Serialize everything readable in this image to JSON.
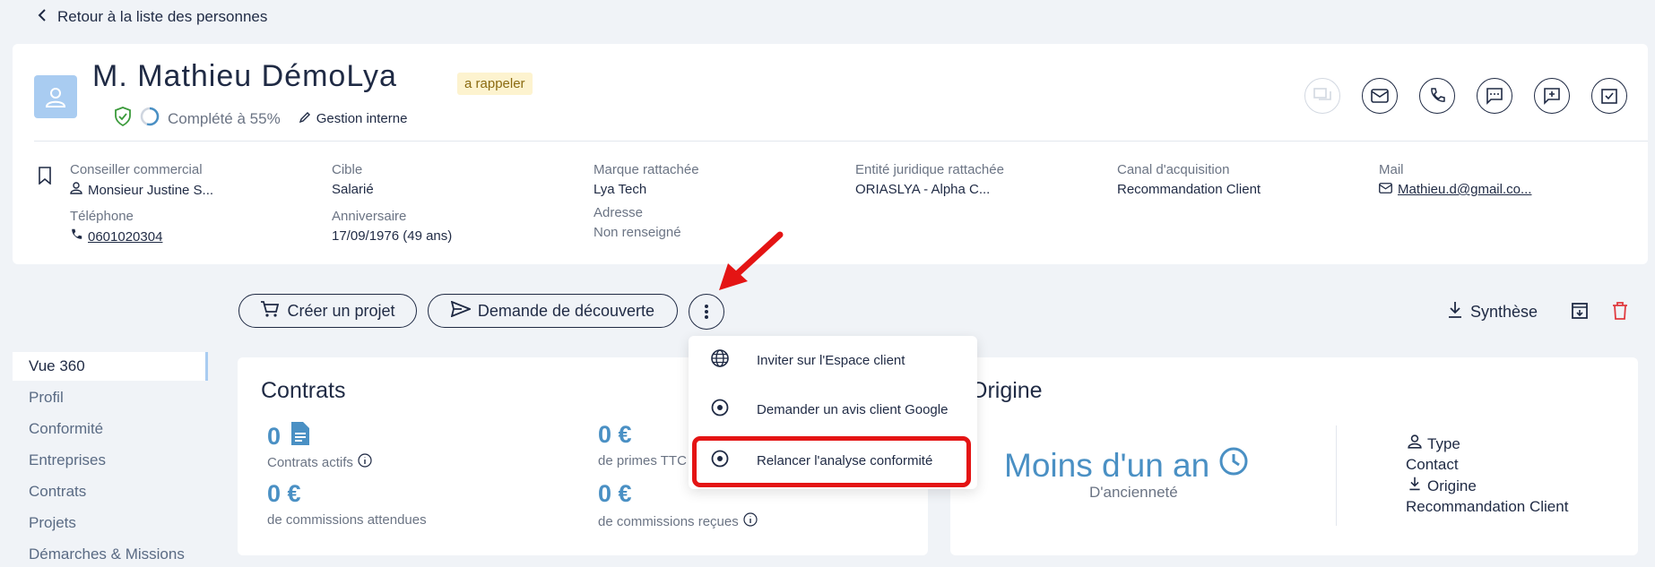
{
  "back_link": "Retour à la liste des personnes",
  "person": {
    "name": "M. Mathieu DémoLya",
    "badge": "a rappeler",
    "completion": "Complété à 55%",
    "completion_fraction": 0.55,
    "internal": "Gestion interne"
  },
  "fields": {
    "conseiller_label": "Conseiller commercial",
    "conseiller_value": "Monsieur Justine S...",
    "telephone_label": "Téléphone",
    "telephone_value": "0601020304",
    "cible_label": "Cible",
    "cible_value": "Salarié",
    "anniversaire_label": "Anniversaire",
    "anniversaire_value": "17/09/1976 (49 ans)",
    "marque_label": "Marque rattachée",
    "marque_value": "Lya Tech",
    "adresse_label": "Adresse",
    "adresse_value": "Non renseigné",
    "entite_label": "Entité juridique rattachée",
    "entite_value": "ORIASLYA - Alpha C...",
    "canal_label": "Canal d'acquisition",
    "canal_value": "Recommandation Client",
    "mail_label": "Mail",
    "mail_value": "Mathieu.d@gmail.co..."
  },
  "actions": {
    "create_project": "Créer un projet",
    "discovery": "Demande de découverte",
    "synthese": "Synthèse"
  },
  "menu": {
    "items": [
      "Inviter sur l'Espace client",
      "Demander un avis client Google",
      "Relancer l'analyse conformité"
    ]
  },
  "sidebar": {
    "items": [
      "Vue 360",
      "Profil",
      "Conformité",
      "Entreprises",
      "Contrats",
      "Projets",
      "Démarches & Missions"
    ]
  },
  "contrats": {
    "title": "Contrats",
    "actifs_value": "0",
    "actifs_label": "Contrats actifs",
    "primes_value": "0 €",
    "primes_label": "de primes TTC",
    "comm_att_value": "0 €",
    "comm_att_label": "de commissions attendues",
    "comm_rec_value": "0 €",
    "comm_rec_label": "de commissions reçues"
  },
  "origine": {
    "title": "Origine",
    "anciennete": "Moins d'un an",
    "anciennete_label": "D'ancienneté",
    "type_label": "Type",
    "type_value": "Contact",
    "origine_label": "Origine",
    "origine_value": "Recommandation Client"
  },
  "colors": {
    "accent": "#4a90c4",
    "navy": "#1f2a44",
    "highlight": "#e41414",
    "badge_bg": "#fdf3cf"
  }
}
